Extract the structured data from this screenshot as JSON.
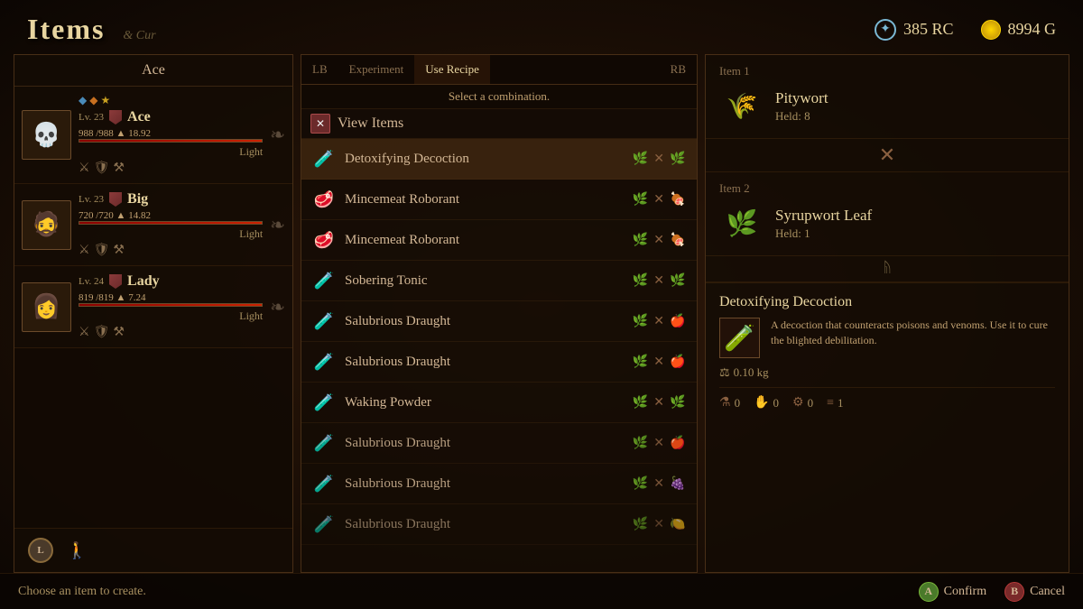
{
  "page": {
    "title": "Items",
    "title_deco": "& Cur"
  },
  "currency": {
    "rc_value": "385 RC",
    "gold_value": "8994 G"
  },
  "party": {
    "header": "Ace",
    "members": [
      {
        "name": "Ace",
        "level": "Lv. 23",
        "hp_current": "988",
        "hp_max": "988",
        "speed": "18.92",
        "style": "Light",
        "hp_pct": 100,
        "avatar": "💀"
      },
      {
        "name": "Big",
        "level": "Lv. 23",
        "hp_current": "720",
        "hp_max": "720",
        "speed": "14.82",
        "style": "Light",
        "hp_pct": 100,
        "avatar": "🧔"
      },
      {
        "name": "Lady",
        "level": "Lv. 24",
        "hp_current": "819",
        "hp_max": "819",
        "speed": "7.24",
        "style": "Light",
        "hp_pct": 100,
        "avatar": "👩"
      }
    ],
    "bottom_hint": "Choose an item to create."
  },
  "recipe_panel": {
    "tab_left": "LB",
    "tab_experiment": "Experiment",
    "tab_use_recipe": "Use Recipe",
    "tab_right": "RB",
    "select_prompt": "Select a combination.",
    "view_items_label": "View Items",
    "items": [
      {
        "name": "Detoxifying Decoction",
        "selected": true,
        "mat1": "🌿",
        "mat2": "🌿",
        "color": "green"
      },
      {
        "name": "Mincemeat Roborant",
        "selected": false,
        "mat1": "🌿",
        "mat2": "🍖",
        "color": "red"
      },
      {
        "name": "Mincemeat Roborant",
        "selected": false,
        "mat1": "🌿",
        "mat2": "🍖",
        "color": "red"
      },
      {
        "name": "Sobering Tonic",
        "selected": false,
        "mat1": "🌿",
        "mat2": "🌿",
        "color": "green"
      },
      {
        "name": "Salubrious Draught",
        "selected": false,
        "mat1": "🌿",
        "mat2": "🍎",
        "color": "red"
      },
      {
        "name": "Salubrious Draught",
        "selected": false,
        "mat1": "🌿",
        "mat2": "🍎",
        "color": "red"
      },
      {
        "name": "Waking Powder",
        "selected": false,
        "mat1": "🌿",
        "mat2": "🌿",
        "color": "green"
      },
      {
        "name": "Salubrious Draught",
        "selected": false,
        "mat1": "🌿",
        "mat2": "🍎",
        "color": "red"
      },
      {
        "name": "Salubrious Draught",
        "selected": false,
        "mat1": "🌿",
        "mat2": "🍇",
        "color": "purple"
      },
      {
        "name": "Salubrious Draught",
        "selected": false,
        "mat1": "🌿",
        "mat2": "🍋",
        "color": "yellow"
      }
    ]
  },
  "detail_panel": {
    "item1_label": "Item 1",
    "item1_name": "Pitywort",
    "item1_held": "Held: 8",
    "connector1": "✕",
    "item2_label": "Item 2",
    "item2_name": "Syrupwort Leaf",
    "item2_held": "Held: 1",
    "connector2": "ᚥ",
    "result_name": "Detoxifying Decoction",
    "result_desc": "A decoction that counteracts poisons and venoms. Use it to cure the blighted debilitation.",
    "result_weight": "0.10 kg",
    "stats": [
      {
        "icon": "⚗",
        "value": "0"
      },
      {
        "icon": "✋",
        "value": "0"
      },
      {
        "icon": "⚙",
        "value": "0"
      },
      {
        "icon": "≡",
        "value": "1"
      }
    ]
  },
  "bottom": {
    "hint": "Choose an item to create.",
    "confirm_label": "Confirm",
    "cancel_label": "Cancel",
    "btn_confirm": "A",
    "btn_cancel": "B"
  }
}
